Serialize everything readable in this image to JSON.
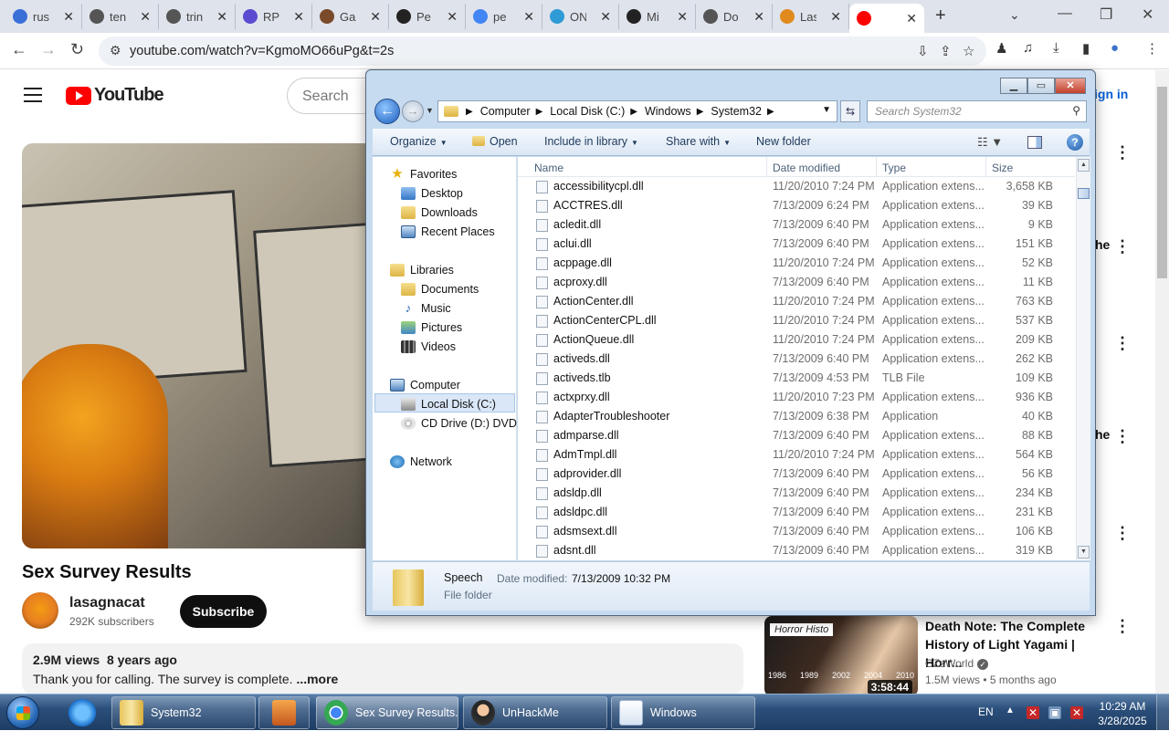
{
  "browser": {
    "tabs": [
      {
        "label": "rus",
        "icon": "wiki-icon",
        "color": "#3b6fd8"
      },
      {
        "label": "ten",
        "icon": "globe-icon",
        "color": "#555555"
      },
      {
        "label": "trin",
        "icon": "globe-icon",
        "color": "#555555"
      },
      {
        "label": "RP",
        "icon": "rp-icon",
        "color": "#5b4bd1"
      },
      {
        "label": "Ga",
        "icon": "avatar-icon",
        "color": "#7a4a2a"
      },
      {
        "label": "Pe",
        "icon": "museum-icon",
        "color": "#222222"
      },
      {
        "label": "pe",
        "icon": "google-icon",
        "color": "#4285f4"
      },
      {
        "label": "ON",
        "icon": "stack-icon",
        "color": "#2e9bd6"
      },
      {
        "label": "Mi",
        "icon": "museum-icon",
        "color": "#222222"
      },
      {
        "label": "Do",
        "icon": "gear-icon",
        "color": "#555555"
      },
      {
        "label": "Las",
        "icon": "cat-icon",
        "color": "#e08a1e"
      },
      {
        "label": "",
        "icon": "youtube-audio-icon",
        "color": "#ff0000",
        "active": true
      }
    ],
    "new_tab": "+",
    "url": "youtube.com/watch?v=KgmoMO66uPg&t=2s"
  },
  "youtube": {
    "logo_text": "YouTube",
    "search_placeholder": "Search",
    "sign_in": "ign in",
    "video_title": "Sex Survey Results",
    "channel_name": "lasagnacat",
    "subscribers": "292K subscribers",
    "subscribe": "Subscribe",
    "views": "2.9M views",
    "age": "8 years ago",
    "description": "Thank you for calling. The survey is complete. ",
    "more": "...more",
    "sidebar_fragments": [
      "he",
      "he"
    ],
    "recommended": {
      "thumb_tag": "Horror Histo",
      "years": [
        "1986",
        "1989",
        "2002",
        "2004",
        "2010"
      ],
      "duration": "3:58:44",
      "title": "Death Note: The Complete History of Light Yagami | Horr...",
      "channel": "CZsWorld",
      "views": "1.5M views",
      "age": "5 months ago"
    }
  },
  "explorer": {
    "path": [
      "Computer",
      "Local Disk (C:)",
      "Windows",
      "System32"
    ],
    "search_placeholder": "Search System32",
    "commands": {
      "organize": "Organize",
      "open": "Open",
      "include": "Include in library",
      "share": "Share with",
      "new_folder": "New folder"
    },
    "nav": {
      "favorites": "Favorites",
      "desktop": "Desktop",
      "downloads": "Downloads",
      "recent": "Recent Places",
      "libraries": "Libraries",
      "documents": "Documents",
      "music": "Music",
      "pictures": "Pictures",
      "videos": "Videos",
      "computer": "Computer",
      "local_disk": "Local Disk (C:)",
      "cd_drive": "CD Drive (D:) DVD1",
      "network": "Network"
    },
    "columns": {
      "name": "Name",
      "date": "Date modified",
      "type": "Type",
      "size": "Size"
    },
    "files": [
      {
        "name": "accessibilitycpl.dll",
        "date": "11/20/2010 7:24 PM",
        "type": "Application extens...",
        "size": "3,658 KB"
      },
      {
        "name": "ACCTRES.dll",
        "date": "7/13/2009 6:24 PM",
        "type": "Application extens...",
        "size": "39 KB"
      },
      {
        "name": "acledit.dll",
        "date": "7/13/2009 6:40 PM",
        "type": "Application extens...",
        "size": "9 KB"
      },
      {
        "name": "aclui.dll",
        "date": "7/13/2009 6:40 PM",
        "type": "Application extens...",
        "size": "151 KB"
      },
      {
        "name": "acppage.dll",
        "date": "11/20/2010 7:24 PM",
        "type": "Application extens...",
        "size": "52 KB"
      },
      {
        "name": "acproxy.dll",
        "date": "7/13/2009 6:40 PM",
        "type": "Application extens...",
        "size": "11 KB"
      },
      {
        "name": "ActionCenter.dll",
        "date": "11/20/2010 7:24 PM",
        "type": "Application extens...",
        "size": "763 KB"
      },
      {
        "name": "ActionCenterCPL.dll",
        "date": "11/20/2010 7:24 PM",
        "type": "Application extens...",
        "size": "537 KB"
      },
      {
        "name": "ActionQueue.dll",
        "date": "11/20/2010 7:24 PM",
        "type": "Application extens...",
        "size": "209 KB"
      },
      {
        "name": "activeds.dll",
        "date": "7/13/2009 6:40 PM",
        "type": "Application extens...",
        "size": "262 KB"
      },
      {
        "name": "activeds.tlb",
        "date": "7/13/2009 4:53 PM",
        "type": "TLB File",
        "size": "109 KB"
      },
      {
        "name": "actxprxy.dll",
        "date": "11/20/2010 7:23 PM",
        "type": "Application extens...",
        "size": "936 KB"
      },
      {
        "name": "AdapterTroubleshooter",
        "date": "7/13/2009 6:38 PM",
        "type": "Application",
        "size": "40 KB"
      },
      {
        "name": "admparse.dll",
        "date": "7/13/2009 6:40 PM",
        "type": "Application extens...",
        "size": "88 KB"
      },
      {
        "name": "AdmTmpl.dll",
        "date": "11/20/2010 7:24 PM",
        "type": "Application extens...",
        "size": "564 KB"
      },
      {
        "name": "adprovider.dll",
        "date": "7/13/2009 6:40 PM",
        "type": "Application extens...",
        "size": "56 KB"
      },
      {
        "name": "adsldp.dll",
        "date": "7/13/2009 6:40 PM",
        "type": "Application extens...",
        "size": "234 KB"
      },
      {
        "name": "adsldpc.dll",
        "date": "7/13/2009 6:40 PM",
        "type": "Application extens...",
        "size": "231 KB"
      },
      {
        "name": "adsmsext.dll",
        "date": "7/13/2009 6:40 PM",
        "type": "Application extens...",
        "size": "106 KB"
      },
      {
        "name": "adsnt.dll",
        "date": "7/13/2009 6:40 PM",
        "type": "Application extens...",
        "size": "319 KB"
      }
    ],
    "details": {
      "name": "Speech",
      "date_label": "Date modified:",
      "date": "7/13/2009 10:32 PM",
      "type": "File folder"
    }
  },
  "taskbar": {
    "buttons": [
      {
        "label": "System32",
        "icon": "folder-icon"
      },
      {
        "label": "",
        "icon": "media-player-icon"
      },
      {
        "label": "Sex Survey Results...",
        "icon": "chrome-icon"
      },
      {
        "label": "UnHackMe",
        "icon": "unhackme-icon"
      },
      {
        "label": "Windows",
        "icon": "document-icon"
      }
    ],
    "language": "EN",
    "time": "10:29 AM",
    "date": "3/28/2025"
  }
}
